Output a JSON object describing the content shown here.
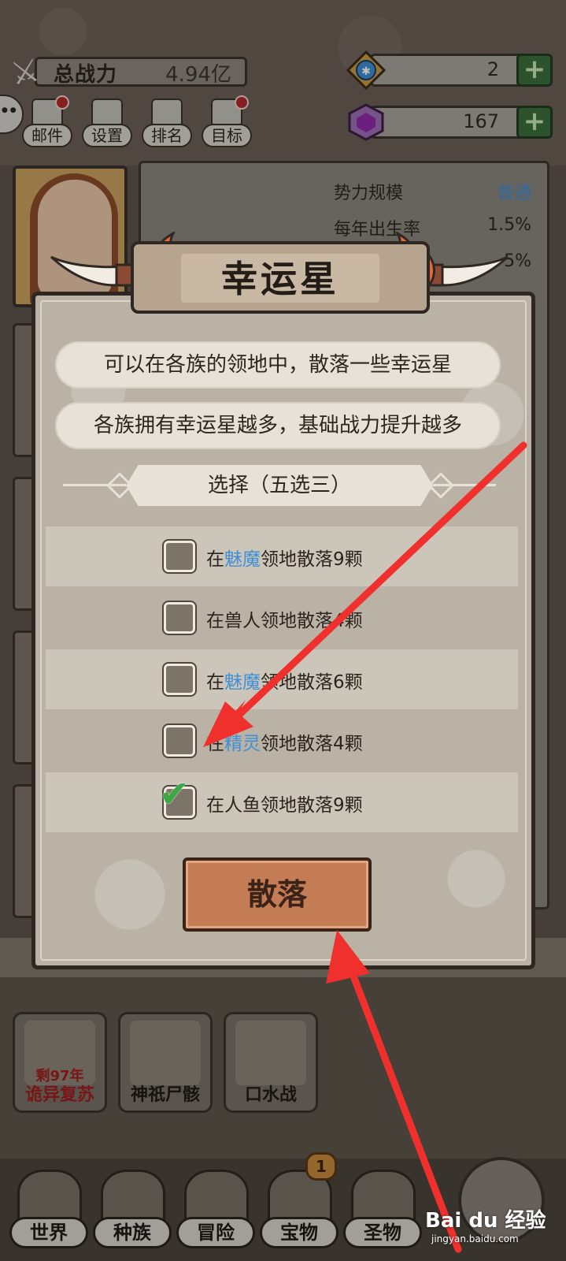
{
  "header": {
    "power_label": "总战力",
    "power_value": "4.94亿",
    "resource1_value": "2",
    "resource2_value": "167",
    "plus_label": "+"
  },
  "menu": [
    {
      "label": "邮件",
      "icon": "mail-icon",
      "badge": true
    },
    {
      "label": "设置",
      "icon": "gear-icon",
      "badge": false
    },
    {
      "label": "排名",
      "icon": "ranking-icon",
      "badge": false
    },
    {
      "label": "目标",
      "icon": "target-icon",
      "badge": true
    }
  ],
  "background_panel": {
    "row1_label": "势力规模",
    "row1_value": "普通",
    "row2_label": "每年出生率",
    "row2_value": "1.5%",
    "row3_value": "5%"
  },
  "modal": {
    "title": "幸运星",
    "desc1": "可以在各族的领地中，散落一些幸运星",
    "desc2": "各族拥有幸运星越多，基础战力提升越多",
    "select_title": "选择（五选三）",
    "options": [
      {
        "prefix": "在",
        "race": "魅魔",
        "suffix": "领地散落9颗",
        "race_highlight": true,
        "checked": false
      },
      {
        "prefix": "在",
        "race": "兽人",
        "suffix": "领地散落4颗",
        "race_highlight": false,
        "checked": false
      },
      {
        "prefix": "在",
        "race": "魅魔",
        "suffix": "领地散落6颗",
        "race_highlight": true,
        "checked": false
      },
      {
        "prefix": "在",
        "race": "精灵",
        "suffix": "领地散落4颗",
        "race_highlight": true,
        "checked": false
      },
      {
        "prefix": "在",
        "race": "人鱼",
        "suffix": "领地散落9颗",
        "race_highlight": false,
        "checked": true
      }
    ],
    "button_label": "散落"
  },
  "features": [
    {
      "label": "诡异复苏",
      "sub": "剩97年",
      "red": true
    },
    {
      "label": "神祇尸骸",
      "sub": "",
      "red": false
    },
    {
      "label": "口水战",
      "sub": "",
      "red": false
    }
  ],
  "nav": [
    {
      "label": "世界"
    },
    {
      "label": "种族"
    },
    {
      "label": "冒险"
    },
    {
      "label": "宝物"
    },
    {
      "label": "圣物"
    }
  ],
  "nav_badge": "1",
  "watermark": {
    "brand": "Bai du 经验",
    "url": "jingyan.baidu.com"
  },
  "colors": {
    "highlight": "#3f8fd6",
    "annotation_arrow": "#f0302c",
    "check": "#3aa843"
  }
}
